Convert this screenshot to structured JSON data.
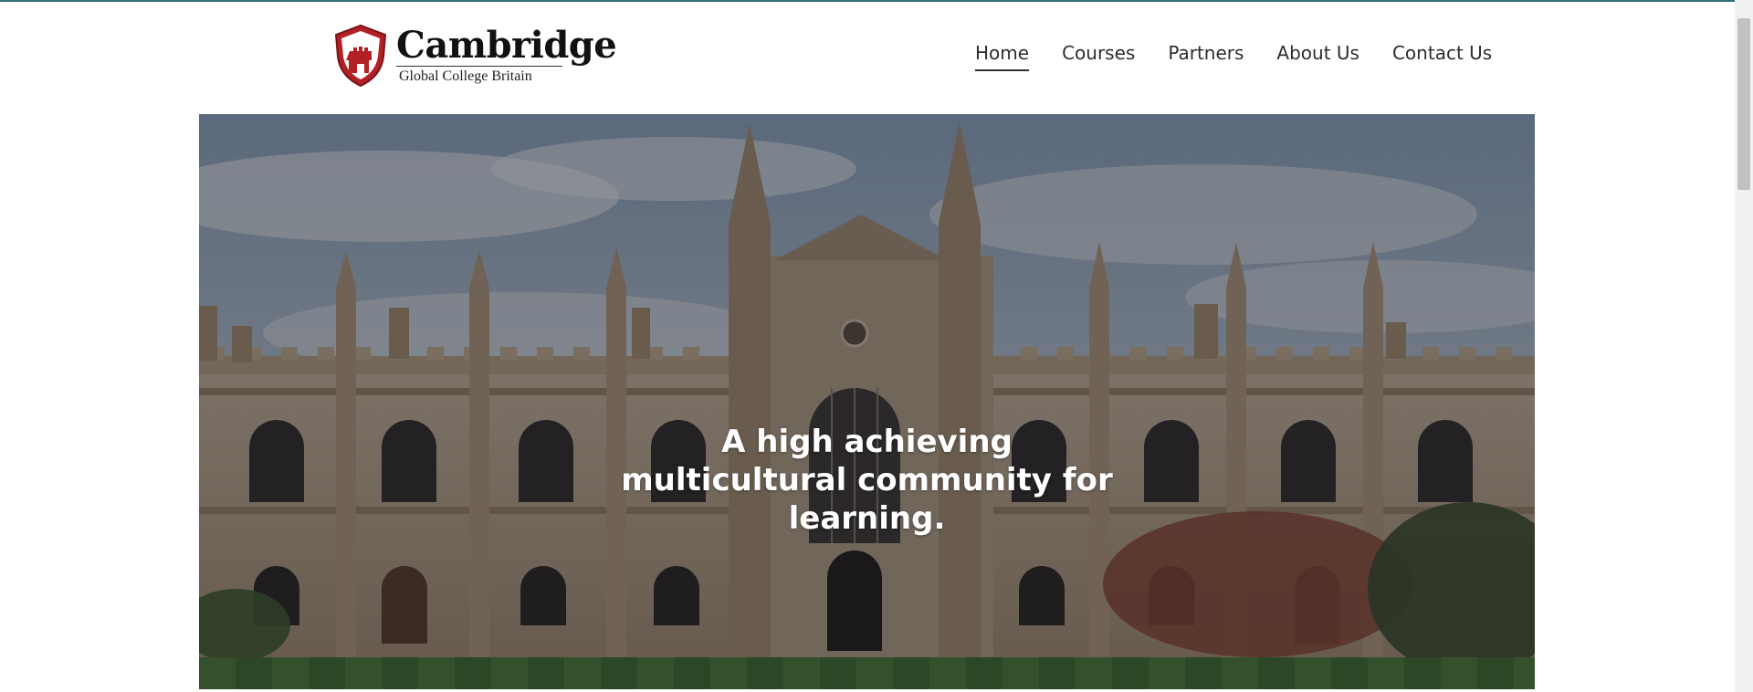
{
  "brand": {
    "name": "Cambridge",
    "tagline": "Global College Britain",
    "accent_color": "#b32126"
  },
  "nav": {
    "items": [
      {
        "label": "Home",
        "active": true
      },
      {
        "label": "Courses",
        "active": false
      },
      {
        "label": "Partners",
        "active": false
      },
      {
        "label": "About Us",
        "active": false
      },
      {
        "label": "Contact Us",
        "active": false
      }
    ]
  },
  "hero": {
    "title": "A high achieving multicultural community for learning."
  },
  "icons": {
    "logo": "castle-shield-icon"
  }
}
